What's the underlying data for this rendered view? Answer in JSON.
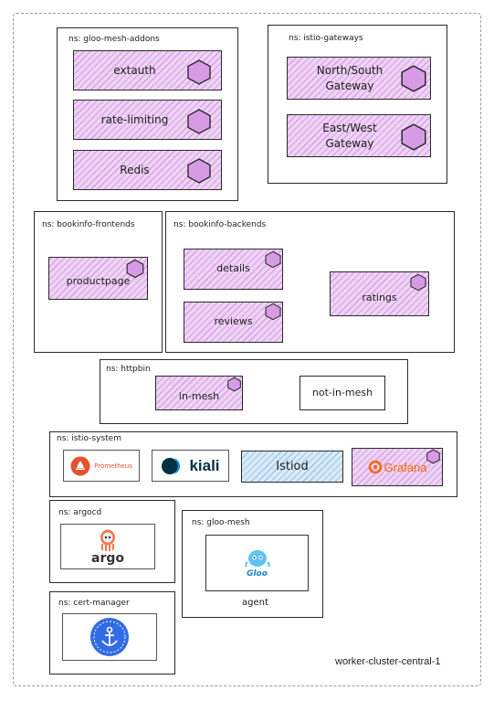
{
  "cluster": {
    "name": "worker-cluster-central-1"
  },
  "namespaces": {
    "addons": {
      "label": "ns: gloo-mesh-addons",
      "services": [
        "extauth",
        "rate-limiting",
        "Redis"
      ]
    },
    "gateways": {
      "label": "ns: istio-gateways",
      "services": [
        "North/South\nGateway",
        "East/West\nGateway"
      ]
    },
    "frontends": {
      "label": "ns: bookinfo-frontends",
      "services": [
        "productpage"
      ]
    },
    "backends": {
      "label": "ns: bookinfo-backends",
      "services": [
        "details",
        "reviews",
        "ratings"
      ]
    },
    "httpbin": {
      "label": "ns: httpbin",
      "services": [
        "in-mesh",
        "not-in-mesh"
      ]
    },
    "istio_system": {
      "label": "ns: istio-system",
      "components": [
        "Prometheus",
        "kiali",
        "Istiod",
        "Grafana"
      ]
    },
    "argocd": {
      "label": "ns: argocd",
      "logo_text": "argo"
    },
    "gloo_mesh": {
      "label": "ns: gloo-mesh",
      "logo_text": "Gloo",
      "agent_label": "agent"
    },
    "cert_manager": {
      "label": "ns: cert-manager",
      "logo_text": "CERT MANAGER"
    }
  },
  "colors": {
    "service_fill": "#eed3f4",
    "hexagon": "#d79be6",
    "istiod_fill": "#d8eaf8",
    "prometheus": "#e6522c",
    "kiali_blue": "#013144",
    "grafana_orange": "#f46800",
    "cert_blue": "#326ce5"
  }
}
